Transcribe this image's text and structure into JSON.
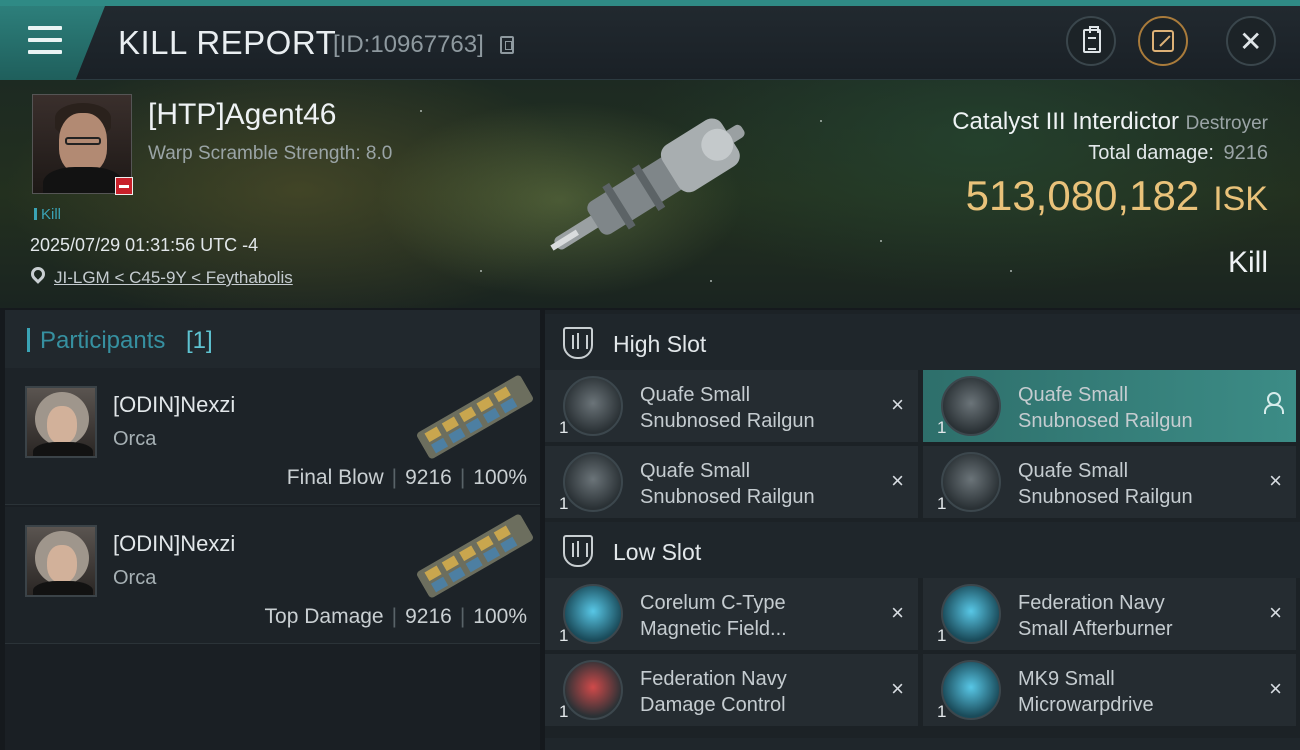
{
  "header": {
    "title": "KILL REPORT",
    "report_id": "[ID:10967763]"
  },
  "victim": {
    "name": "[HTP]Agent46",
    "warp_scramble": "Warp Scramble Strength: 8.0",
    "tag": "Kill",
    "timestamp": "2025/07/29 01:31:56 UTC -4",
    "location": "JI-LGM < C45-9Y < Feythabolis",
    "ship_name": "Catalyst III Interdictor",
    "ship_class": "Destroyer",
    "total_damage_label": "Total damage:",
    "total_damage": "9216",
    "isk_value": "513,080,182",
    "isk_unit": "ISK",
    "result": "Kill"
  },
  "participants": {
    "title": "Participants",
    "count": "[1]",
    "items": [
      {
        "name": "[ODIN]Nexzi",
        "ship": "Orca",
        "role": "Final Blow",
        "damage": "9216",
        "percent": "100%"
      },
      {
        "name": "[ODIN]Nexzi",
        "ship": "Orca",
        "role": "Top Damage",
        "damage": "9216",
        "percent": "100%"
      }
    ]
  },
  "slots": {
    "high": {
      "title": "High Slot",
      "modules": [
        {
          "qty": "1",
          "line1": "Quafe Small",
          "line2": "Snubnosed Railgun",
          "status": "destroyed"
        },
        {
          "qty": "1",
          "line1": "Quafe Small",
          "line2": "Snubnosed Railgun",
          "status": "dropped"
        },
        {
          "qty": "1",
          "line1": "Quafe Small",
          "line2": "Snubnosed Railgun",
          "status": "destroyed"
        },
        {
          "qty": "1",
          "line1": "Quafe Small",
          "line2": "Snubnosed Railgun",
          "status": "destroyed"
        }
      ]
    },
    "low": {
      "title": "Low Slot",
      "modules": [
        {
          "qty": "1",
          "line1": "Corelum C-Type",
          "line2": "Magnetic Field...",
          "status": "destroyed"
        },
        {
          "qty": "1",
          "line1": "Federation Navy",
          "line2": "Small Afterburner",
          "status": "destroyed"
        },
        {
          "qty": "1",
          "line1": "Federation Navy",
          "line2": "Damage Control",
          "status": "destroyed"
        },
        {
          "qty": "1",
          "line1": "MK9 Small",
          "line2": "Microwarpdrive",
          "status": "destroyed"
        }
      ]
    }
  },
  "icons": {
    "destroyed": "×",
    "close": "✕"
  },
  "colors": {
    "accent": "#2f8a85",
    "isk_gold": "#e9c27a",
    "participants_cyan": "#3aa3b5",
    "dropped_teal": "#3c8c86"
  }
}
